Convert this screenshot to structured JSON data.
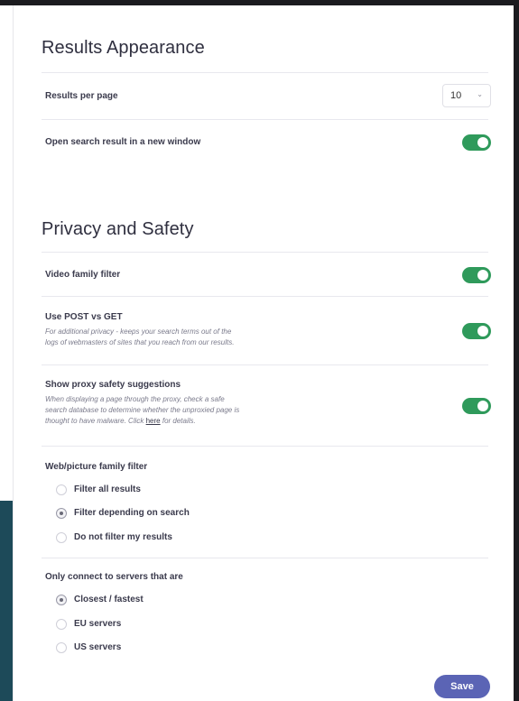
{
  "results_appearance": {
    "title": "Results Appearance",
    "results_per_page": {
      "label": "Results per page",
      "value": "10",
      "chevron": "chevron-down-icon"
    },
    "open_new_window": {
      "label": "Open search result in a new window",
      "enabled": true
    }
  },
  "privacy_safety": {
    "title": "Privacy and Safety",
    "video_family_filter": {
      "label": "Video family filter",
      "enabled": true
    },
    "post_vs_get": {
      "label": "Use POST vs GET",
      "desc_line1": "For additional privacy - keeps your search terms out of the",
      "desc_line2": "logs of webmasters of sites that you reach from our results.",
      "enabled": true
    },
    "proxy_safety": {
      "label": "Show proxy safety suggestions",
      "desc_line1": "When displaying a page through the proxy, check a safe",
      "desc_line2": "search database to determine whether the unproxied page is",
      "desc_line3_a": "thought to have malware. Click ",
      "desc_link": "here",
      "desc_line3_b": " for details.",
      "enabled": true
    },
    "web_picture_filter": {
      "label": "Web/picture family filter",
      "options": [
        "Filter all results",
        "Filter depending on search",
        "Do not filter my results"
      ],
      "selected": 1
    },
    "servers": {
      "label": "Only connect to servers that are",
      "options": [
        "Closest / fastest",
        "EU servers",
        "US servers"
      ],
      "selected": 0
    }
  },
  "save_label": "Save",
  "colors": {
    "toggle_on": "#2f9a5b",
    "save_button": "#5b64b5",
    "side_strip": "#1d4a59"
  }
}
